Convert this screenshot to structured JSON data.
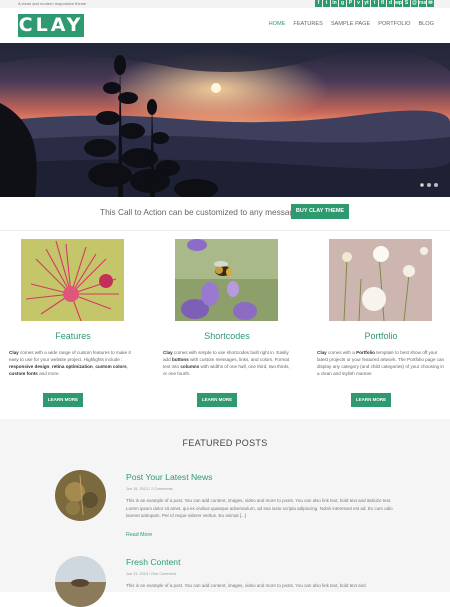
{
  "topbar": {
    "tagline": "A clean and modern responsive theme",
    "socials": [
      "f",
      "t",
      "in",
      "g",
      "P",
      "v",
      "yt",
      "t",
      "fl",
      "d",
      "wp",
      "S",
      "@",
      "rss",
      "✉"
    ]
  },
  "header": {
    "logo": "CLAY",
    "nav": [
      "HOME",
      "FEATURES",
      "SAMPLE PAGE",
      "PORTFOLIO",
      "BLOG"
    ]
  },
  "cta": {
    "text": "This Call to Action can be customized to any message.",
    "button": "BUY CLAY THEME"
  },
  "features": [
    {
      "title": "Features",
      "segments": [
        {
          "t": "Clay",
          "b": true
        },
        {
          "t": " comes with a wide range of custom features to make it easy to use for your website project. Highlights include : "
        },
        {
          "t": "responsive design",
          "b": true
        },
        {
          "t": ", "
        },
        {
          "t": "retina optimization",
          "b": true
        },
        {
          "t": ", "
        },
        {
          "t": "custom colors",
          "b": true
        },
        {
          "t": ", "
        },
        {
          "t": "custom fonts",
          "b": true
        },
        {
          "t": " and more."
        }
      ],
      "button": "LEARN MORE"
    },
    {
      "title": "Shortcodes",
      "segments": [
        {
          "t": "Clay",
          "b": true
        },
        {
          "t": " comes with simple to use shortcodes built right in. Easily add "
        },
        {
          "t": "buttons",
          "b": true
        },
        {
          "t": " with custom messages, links, and colors. Format text into "
        },
        {
          "t": "columns",
          "b": true
        },
        {
          "t": " with widths of one half, one third, two thirds, or one fourth."
        }
      ],
      "button": "LEARN MORE"
    },
    {
      "title": "Portfolio",
      "segments": [
        {
          "t": "Clay",
          "b": true
        },
        {
          "t": " comes with a "
        },
        {
          "t": "Portfolio",
          "b": true
        },
        {
          "t": " template to best show off your latest projects or your featured artwork. The Portfolio page can display any category (and child categories) of your choosing in a clean and stylish manner."
        }
      ],
      "button": "LEARN MORE"
    }
  ],
  "featured_posts": {
    "heading": "FEATURED POSTS",
    "posts": [
      {
        "title": "Post Your Latest News",
        "meta": "Jun 15, 2013 / 2 Comments",
        "excerpt": "This is an example of a post. You can add content, images, video and more to posts. You can also link text, bold text and italicize text. Lorem ipsum dolor sit amet, qui ex civibus quaeque adversarium, ad sea iusto scripta adipiscing. Nobis interesset est ad. Ex cum odio laoreet antiopam. Per id reque viderer veritus. Eu animal [...]",
        "read_more": "Read More"
      },
      {
        "title": "Fresh Content",
        "meta": "Jun 13, 2013 / One Comment",
        "excerpt": "This is an example of a post. You can add content, images, video and more to posts. You can also link text, bold text and"
      }
    ]
  }
}
